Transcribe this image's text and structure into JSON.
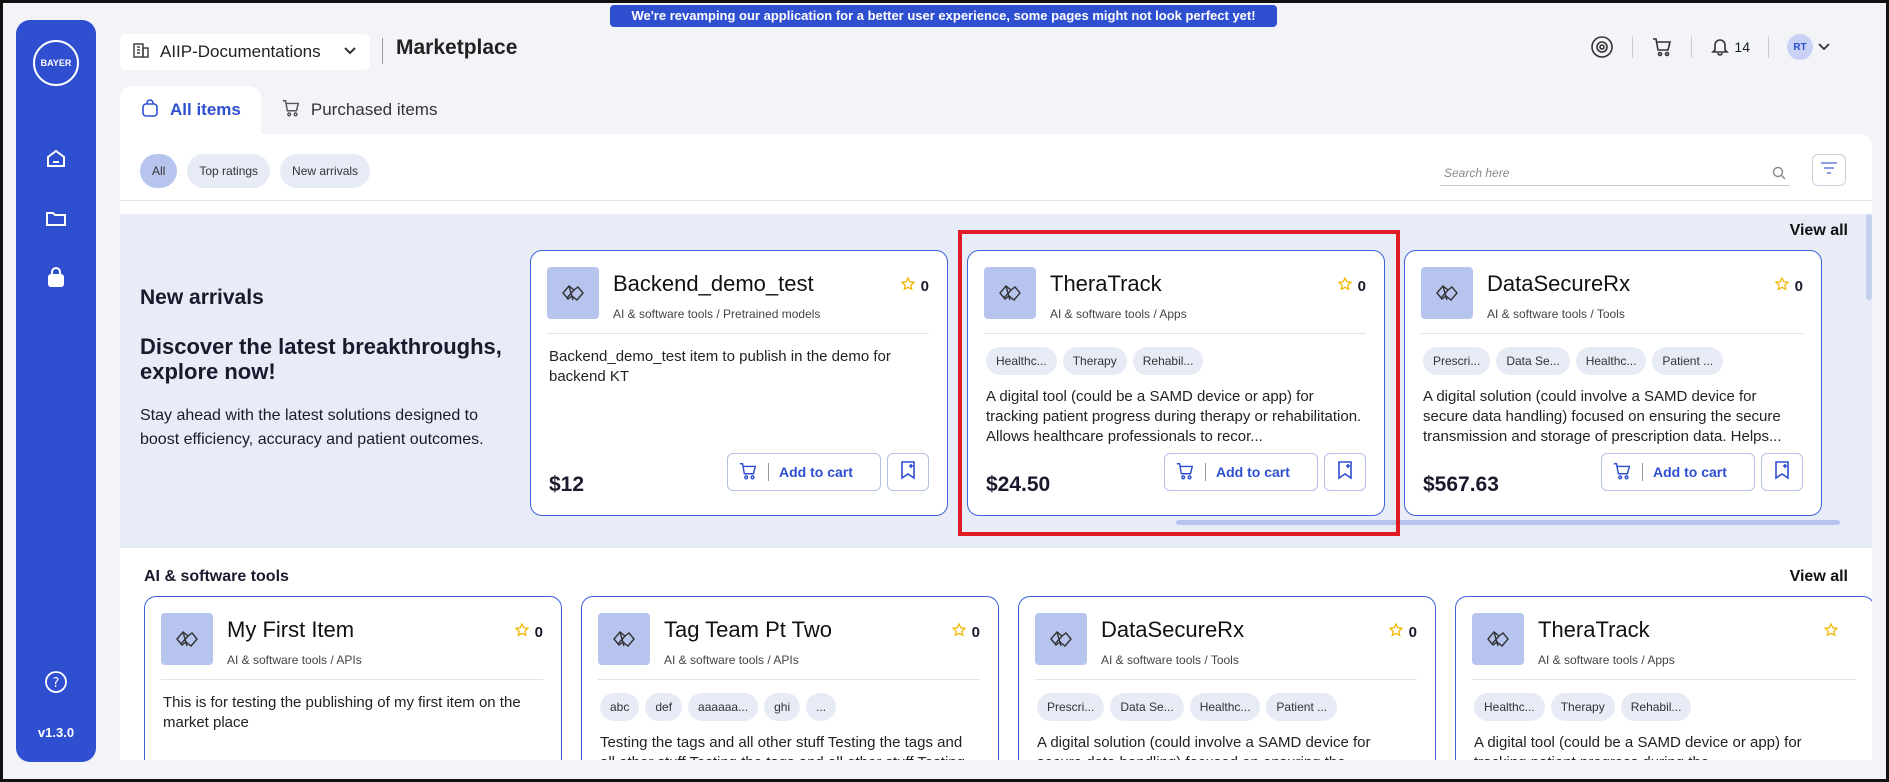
{
  "banner": "We're revamping our application for a better user experience, some pages might not look perfect yet!",
  "sidebar": {
    "logo": "BAYER",
    "items": [
      "home-icon",
      "folder-icon",
      "marketplace-icon"
    ],
    "help": "help-icon",
    "version": "v1.3.0"
  },
  "header": {
    "workspace": "AIIP-Documentations",
    "title": "Marketplace",
    "notifications": "14",
    "avatar": "RT"
  },
  "tabs": [
    {
      "label": "All items",
      "active": true
    },
    {
      "label": "Purchased items",
      "active": false
    }
  ],
  "filters": [
    {
      "label": "All",
      "active": true
    },
    {
      "label": "Top ratings",
      "active": false
    },
    {
      "label": "New arrivals",
      "active": false
    }
  ],
  "search": {
    "placeholder": "Search here"
  },
  "arrivals": {
    "title": "New arrivals",
    "subtitle": "Discover the latest breakthroughs, explore now!",
    "description": "Stay ahead with the latest solutions designed to boost efficiency, accuracy and patient outcomes.",
    "view_all": "View all",
    "cards": [
      {
        "name": "Backend_demo_test",
        "path": "AI & software tools / Pretrained models",
        "rating": "0",
        "tags": [],
        "desc": "Backend_demo_test item to publish in the demo for backend KT",
        "price": "$12",
        "cart": "Add to cart"
      },
      {
        "name": "TheraTrack",
        "path": "AI & software tools / Apps",
        "rating": "0",
        "tags": [
          "Healthc...",
          "Therapy",
          "Rehabil..."
        ],
        "desc": "A digital tool (could be a SAMD device or app) for tracking patient progress during therapy or rehabilitation. Allows healthcare professionals to recor...",
        "price": "$24.50",
        "cart": "Add to cart"
      },
      {
        "name": "DataSecureRx",
        "path": "AI & software tools / Tools",
        "rating": "0",
        "tags": [
          "Prescri...",
          "Data Se...",
          "Healthc...",
          "Patient ..."
        ],
        "desc": "A digital solution (could involve a SAMD device for secure data handling) focused on ensuring the secure transmission and storage of prescription data. Helps...",
        "price": "$567.63",
        "cart": "Add to cart"
      }
    ]
  },
  "ai_tools": {
    "title": "AI & software tools",
    "view_all": "View all",
    "cards": [
      {
        "name": "My First Item",
        "path": "AI & software tools / APIs",
        "rating": "0",
        "tags": [],
        "desc": "This is for testing the publishing of my first item on the market place"
      },
      {
        "name": "Tag Team Pt Two",
        "path": "AI & software tools / APIs",
        "rating": "0",
        "tags": [
          "abc",
          "def",
          "aaaaaa...",
          "ghi",
          "..."
        ],
        "desc": "Testing the tags and all other stuff Testing the tags and all other stuff Testing the tags and all other stuff Testing"
      },
      {
        "name": "DataSecureRx",
        "path": "AI & software tools / Tools",
        "rating": "0",
        "tags": [
          "Prescri...",
          "Data Se...",
          "Healthc...",
          "Patient ..."
        ],
        "desc": "A digital solution (could involve a SAMD device for secure data handling) focused on ensuring the"
      },
      {
        "name": "TheraTrack",
        "path": "AI & software tools / Apps",
        "rating": "",
        "tags": [
          "Healthc...",
          "Therapy",
          "Rehabil..."
        ],
        "desc": "A digital tool (could be a SAMD device or app) for tracking patient progress during the"
      }
    ]
  },
  "colors": {
    "accent": "#2f4fd1",
    "highlight": "#e01b24",
    "star": "#f2b705"
  }
}
